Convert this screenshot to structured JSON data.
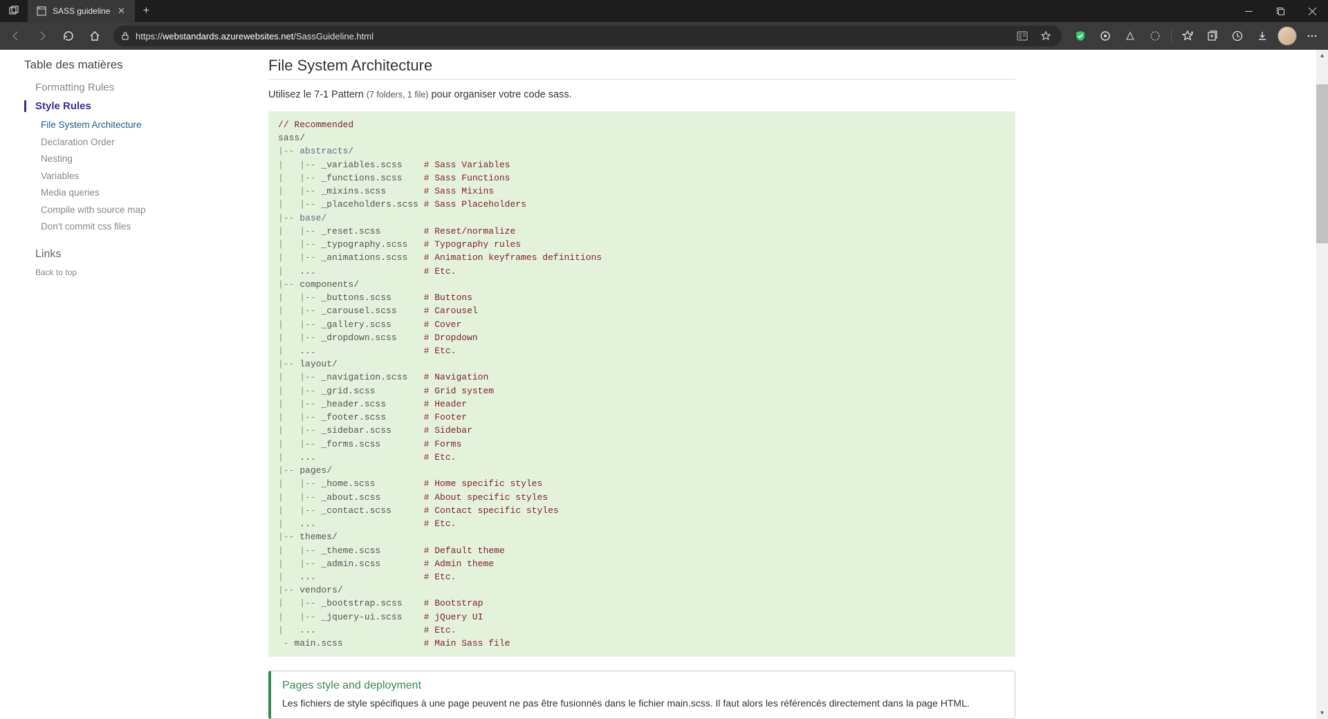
{
  "browser": {
    "tab_title": "SASS guideline",
    "url_scheme": "https://",
    "url_host": "webstandards.azurewebsites.net",
    "url_path": "/SassGuideline.html"
  },
  "sidebar": {
    "toc_title": "Table des matières",
    "items": [
      {
        "label": "Formatting Rules",
        "level": 1,
        "active": false
      },
      {
        "label": "Style Rules",
        "level": 1,
        "active": true
      },
      {
        "label": "File System Architecture",
        "level": 2,
        "active": true
      },
      {
        "label": "Declaration Order",
        "level": 2,
        "active": false
      },
      {
        "label": "Nesting",
        "level": 2,
        "active": false
      },
      {
        "label": "Variables",
        "level": 2,
        "active": false
      },
      {
        "label": "Media queries",
        "level": 2,
        "active": false
      },
      {
        "label": "Compile with source map",
        "level": 2,
        "active": false
      },
      {
        "label": "Don't commit css files",
        "level": 2,
        "active": false
      }
    ],
    "links_title": "Links",
    "back_to_top": "Back to top"
  },
  "content": {
    "heading": "File System Architecture",
    "intro_pre": "Utilisez le 7-1 Pattern ",
    "intro_small": "(7 folders, 1 file)",
    "intro_post": " pour organiser votre code sass.",
    "code_lines": [
      {
        "t": "comment",
        "text": "// Recommended"
      },
      {
        "t": "plain",
        "text": "sass/"
      },
      {
        "t": "tree",
        "prefix": "|-- ",
        "name": "abstracts/",
        "folder": true
      },
      {
        "t": "tree",
        "prefix": "|   |-- ",
        "name": "_variables.scss",
        "pad": 4,
        "comment": "# Sass Variables"
      },
      {
        "t": "tree",
        "prefix": "|   |-- ",
        "name": "_functions.scss",
        "pad": 4,
        "comment": "# Sass Functions"
      },
      {
        "t": "tree",
        "prefix": "|   |-- ",
        "name": "_mixins.scss",
        "pad": 7,
        "comment": "# Sass Mixins"
      },
      {
        "t": "tree",
        "prefix": "|   |-- ",
        "name": "_placeholders.scss",
        "pad": 1,
        "comment": "# Sass Placeholders"
      },
      {
        "t": "tree",
        "prefix": "|-- ",
        "name": "base/",
        "folder": true
      },
      {
        "t": "tree",
        "prefix": "|   |-- ",
        "name": "_reset.scss",
        "pad": 8,
        "comment": "# Reset/normalize"
      },
      {
        "t": "tree",
        "prefix": "|   |-- ",
        "name": "_typography.scss",
        "pad": 3,
        "comment": "# Typography rules"
      },
      {
        "t": "tree",
        "prefix": "|   |-- ",
        "name": "_animations.scss",
        "pad": 3,
        "comment": "# Animation keyframes definitions"
      },
      {
        "t": "tree",
        "prefix": "|   ",
        "name": "...",
        "pad": 20,
        "comment": "# Etc."
      },
      {
        "t": "tree",
        "prefix": "|-- ",
        "name": "components/",
        "folder": false
      },
      {
        "t": "tree",
        "prefix": "|   |-- ",
        "name": "_buttons.scss",
        "pad": 6,
        "comment": "# Buttons"
      },
      {
        "t": "tree",
        "prefix": "|   |-- ",
        "name": "_carousel.scss",
        "pad": 5,
        "comment": "# Carousel"
      },
      {
        "t": "tree",
        "prefix": "|   |-- ",
        "name": "_gallery.scss",
        "pad": 6,
        "comment": "# Cover"
      },
      {
        "t": "tree",
        "prefix": "|   |-- ",
        "name": "_dropdown.scss",
        "pad": 5,
        "comment": "# Dropdown"
      },
      {
        "t": "tree",
        "prefix": "|   ",
        "name": "...",
        "pad": 20,
        "comment": "# Etc."
      },
      {
        "t": "tree",
        "prefix": "|-- ",
        "name": "layout/",
        "folder": false
      },
      {
        "t": "tree",
        "prefix": "|   |-- ",
        "name": "_navigation.scss",
        "pad": 3,
        "comment": "# Navigation"
      },
      {
        "t": "tree",
        "prefix": "|   |-- ",
        "name": "_grid.scss",
        "pad": 9,
        "comment": "# Grid system"
      },
      {
        "t": "tree",
        "prefix": "|   |-- ",
        "name": "_header.scss",
        "pad": 7,
        "comment": "# Header"
      },
      {
        "t": "tree",
        "prefix": "|   |-- ",
        "name": "_footer.scss",
        "pad": 7,
        "comment": "# Footer"
      },
      {
        "t": "tree",
        "prefix": "|   |-- ",
        "name": "_sidebar.scss",
        "pad": 6,
        "comment": "# Sidebar"
      },
      {
        "t": "tree",
        "prefix": "|   |-- ",
        "name": "_forms.scss",
        "pad": 8,
        "comment": "# Forms"
      },
      {
        "t": "tree",
        "prefix": "|   ",
        "name": "...",
        "pad": 20,
        "comment": "# Etc."
      },
      {
        "t": "tree",
        "prefix": "|-- ",
        "name": "pages/",
        "folder": false
      },
      {
        "t": "tree",
        "prefix": "|   |-- ",
        "name": "_home.scss",
        "pad": 9,
        "comment": "# Home specific styles"
      },
      {
        "t": "tree",
        "prefix": "|   |-- ",
        "name": "_about.scss",
        "pad": 8,
        "comment": "# About specific styles"
      },
      {
        "t": "tree",
        "prefix": "|   |-- ",
        "name": "_contact.scss",
        "pad": 6,
        "comment": "# Contact specific styles"
      },
      {
        "t": "tree",
        "prefix": "|   ",
        "name": "...",
        "pad": 20,
        "comment": "# Etc."
      },
      {
        "t": "tree",
        "prefix": "|-- ",
        "name": "themes/",
        "folder": false
      },
      {
        "t": "tree",
        "prefix": "|   |-- ",
        "name": "_theme.scss",
        "pad": 8,
        "comment": "# Default theme"
      },
      {
        "t": "tree",
        "prefix": "|   |-- ",
        "name": "_admin.scss",
        "pad": 8,
        "comment": "# Admin theme"
      },
      {
        "t": "tree",
        "prefix": "|   ",
        "name": "...",
        "pad": 20,
        "comment": "# Etc."
      },
      {
        "t": "tree",
        "prefix": "|-- ",
        "name": "vendors/",
        "folder": false
      },
      {
        "t": "tree",
        "prefix": "|   |-- ",
        "name": "_bootstrap.scss",
        "pad": 4,
        "comment": "# Bootstrap"
      },
      {
        "t": "tree",
        "prefix": "|   |-- ",
        "name": "_jquery-ui.scss",
        "pad": 4,
        "comment": "# jQuery UI"
      },
      {
        "t": "tree",
        "prefix": "|   ",
        "name": "...",
        "pad": 20,
        "comment": "# Etc."
      },
      {
        "t": "tree",
        "prefix": " - ",
        "name": "main.scss",
        "pad": 15,
        "comment": "# Main Sass file"
      }
    ],
    "note_title": "Pages style and deployment",
    "note_body": "Les fichiers de style spécifiques à une page peuvent ne pas être fusionnés dans le fichier main.scss. Il faut alors les référencés directement dans la page HTML."
  }
}
